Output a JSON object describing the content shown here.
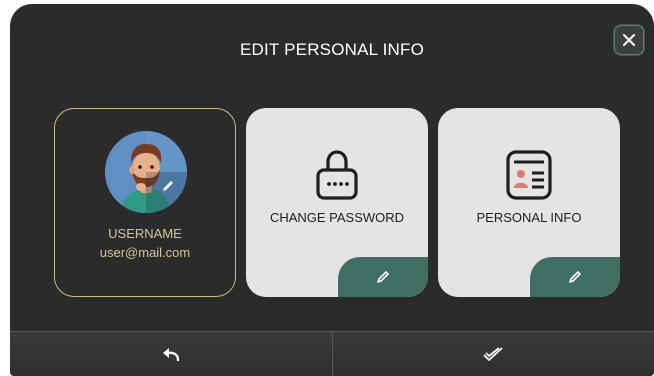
{
  "dialog": {
    "title": "EDIT PERSONAL INFO",
    "close_icon": "close-icon"
  },
  "profile_card": {
    "username": "USERNAME",
    "email": "user@mail.com",
    "edit_icon": "pencil-icon"
  },
  "cards": [
    {
      "label": "CHANGE PASSWORD",
      "icon": "lock-icon",
      "edit_icon": "pencil-icon"
    },
    {
      "label": "PERSONAL INFO",
      "icon": "id-card-icon",
      "edit_icon": "pencil-icon"
    }
  ],
  "footer": {
    "back_icon": "undo-icon",
    "confirm_icon": "checkmark-icon"
  },
  "colors": {
    "background": "#2b2b2b",
    "accent_green": "#3f6e63",
    "profile_text": "#d2c59c",
    "card_light": "#e4e4e4"
  }
}
